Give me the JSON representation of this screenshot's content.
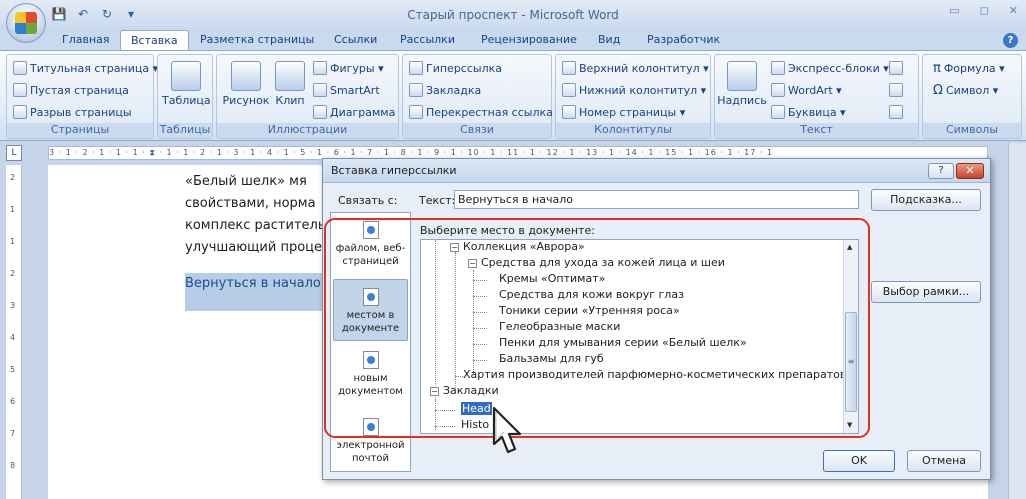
{
  "window": {
    "title": "Старый проспект - Microsoft Word"
  },
  "qat": {
    "save": "💾",
    "undo": "↶",
    "redo": "↻",
    "more": "▾"
  },
  "tabs": [
    "Главная",
    "Вставка",
    "Разметка страницы",
    "Ссылки",
    "Рассылки",
    "Рецензирование",
    "Вид",
    "Разработчик"
  ],
  "ribbon": {
    "pages": {
      "label": "Страницы",
      "items": [
        "Титульная страница ▾",
        "Пустая страница",
        "Разрыв страницы"
      ]
    },
    "tables": {
      "label": "Таблицы",
      "item": "Таблица"
    },
    "illustrations": {
      "label": "Иллюстрации",
      "picture": "Рисунок",
      "clip": "Клип",
      "items": [
        "Фигуры ▾",
        "SmartArt",
        "Диаграмма"
      ]
    },
    "links": {
      "label": "Связи",
      "items": [
        "Гиперссылка",
        "Закладка",
        "Перекрестная ссылка"
      ]
    },
    "headers": {
      "label": "Колонтитулы",
      "items": [
        "Верхний колонтитул ▾",
        "Нижний колонтитул ▾",
        "Номер страницы ▾"
      ]
    },
    "text": {
      "label": "Текст",
      "textbox": "Надпись",
      "items": [
        "Экспресс-блоки ▾",
        "WordArt ▾",
        "Буквица ▾"
      ]
    },
    "symbols": {
      "label": "Символы",
      "items": [
        "Формула ▾",
        "Символ ▾"
      ]
    }
  },
  "ruler": {
    "h": "3 · 1 · 2 · 1 · 1 · 1 · ⧗ · 1 · 1 · 2 · 1 · 3 · 1 · 4 · 1 · 5 · 1 · 6 · 1 · 7 · 1 · 8 · 1 · 9 · 1 · 10 · 1 · 11 · 1 · 12 · 1 · 13 · 1 · 14 · 1 · 15 · 1 · 16 · 1 · 17 · 1",
    "corner": "L",
    "v": [
      "2",
      "1",
      "1",
      "2",
      "3",
      "4",
      "5",
      "6",
      "7",
      "8"
    ]
  },
  "document": {
    "lines": [
      "«Белый шелк» мя",
      "свойствами, норма",
      "комплекс раститель",
      "улучшающий проце"
    ],
    "link_text": "Вернуться в начало"
  },
  "dialog": {
    "title": "Вставка гиперссылки",
    "help": "?",
    "close": "✕",
    "link_to_label": "Связать с:",
    "text_label": "Текст:",
    "text_value": "Вернуться в начало",
    "hint_button": "Подсказка...",
    "place_label": "Выберите место в документе:",
    "frame_button": "Выбор рамки...",
    "ok": "OK",
    "cancel": "Отмена",
    "linkbar": [
      "файлом, веб-страницей",
      "местом в документе",
      "новым документом",
      "электронной почтой"
    ],
    "tree": {
      "collection": "Коллекция «Аврора»",
      "skin": "Средства для ухода за кожей лица и шеи",
      "leaves": [
        "Кремы «Оптимат»",
        "Средства для кожи вокруг глаз",
        "Тоники серии «Утренняя роса»",
        "Гелеобразные маски",
        "Пенки для умывания серии «Белый шелк»",
        "Бальзамы для губ"
      ],
      "charter": "Хартия производителей парфюмерно-косметических препаратов",
      "bookmarks": "Закладки",
      "bm1": "Head",
      "bm2": "Histo"
    }
  }
}
